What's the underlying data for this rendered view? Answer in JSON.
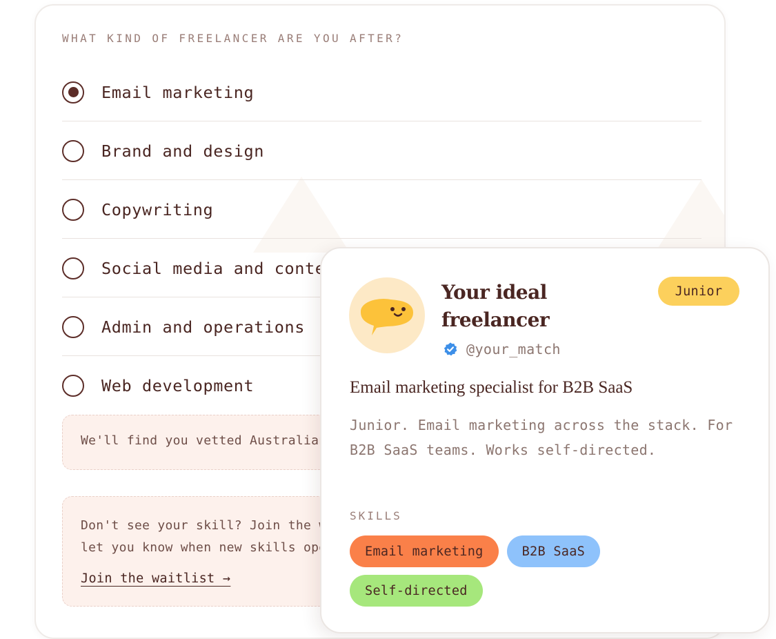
{
  "question": {
    "label": "WHAT KIND OF FREELANCER ARE YOU AFTER?",
    "options": [
      {
        "label": "Email marketing",
        "selected": true
      },
      {
        "label": "Brand and design",
        "selected": false
      },
      {
        "label": "Copywriting",
        "selected": false
      },
      {
        "label": "Social media and content",
        "selected": false
      },
      {
        "label": "Admin and operations",
        "selected": false
      },
      {
        "label": "Web development",
        "selected": false
      }
    ],
    "notice": "We'll find you vetted Australian freelancers.",
    "waitlist": {
      "text": "Don't see your skill? Join the waitlist and we'll let you know when new skills open up.",
      "link": "Join the waitlist →"
    }
  },
  "profile": {
    "name": "Your ideal freelancer",
    "handle": "@your_match",
    "level": "Junior",
    "headline": "Email marketing specialist for B2B SaaS",
    "summary": "Junior. Email marketing across the stack. For B2B SaaS teams. Works self-directed.",
    "skills_label": "SKILLS",
    "skills": [
      {
        "label": "Email marketing",
        "color": "#fa8049"
      },
      {
        "label": "B2B SaaS",
        "color": "#8ec2fb"
      },
      {
        "label": "Self-directed",
        "color": "#a6e77c"
      }
    ],
    "avatar_icon": "smiling-speech-bubble-icon",
    "verified_icon": "verified-check-icon"
  },
  "colors": {
    "text": "#4a2622",
    "muted": "#8c7670",
    "badge": "#fcd05c",
    "notice_bg": "#fdf1ec",
    "verified": "#3d8fe8",
    "avatar_bg": "#fde9c6",
    "bubble": "#fcc23a"
  }
}
